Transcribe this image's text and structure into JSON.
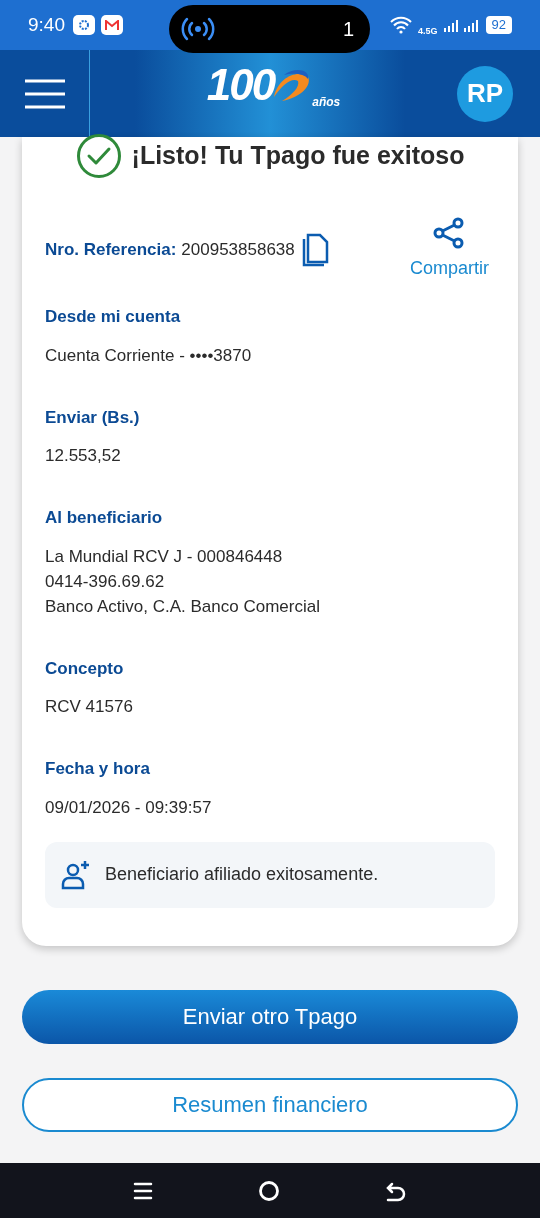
{
  "status_bar": {
    "time": "9:40",
    "pill_count": "1",
    "network": "4.5G",
    "battery": "92"
  },
  "header": {
    "logo_number": "100",
    "logo_suffix": "años",
    "avatar_initials": "RP"
  },
  "result": {
    "title": "¡Listo! Tu Tpago fue exitoso",
    "reference_label": "Nro. Referencia:",
    "reference_value": "200953858638",
    "share_label": "Compartir"
  },
  "details": [
    {
      "label": "Desde mi cuenta",
      "lines": [
        "Cuenta Corriente - ••••3870"
      ]
    },
    {
      "label": "Enviar (Bs.)",
      "lines": [
        "12.553,52"
      ]
    },
    {
      "label": "Al beneficiario",
      "lines": [
        "La Mundial RCV J - 000846448",
        "0414-396.69.62",
        "Banco Activo, C.A. Banco Comercial"
      ]
    },
    {
      "label": "Concepto",
      "lines": [
        "RCV 41576"
      ]
    },
    {
      "label": "Fecha y hora",
      "lines": [
        "09/01/2026 - 09:39:57"
      ]
    }
  ],
  "notice": "Beneficiario afiliado exitosamente.",
  "buttons": [
    {
      "label": "Enviar otro Tpago",
      "kind": "primary"
    },
    {
      "label": "Resumen financiero",
      "kind": "outline"
    }
  ]
}
